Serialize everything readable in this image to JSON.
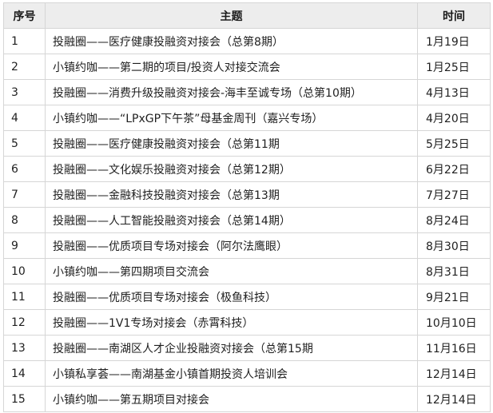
{
  "table": {
    "headers": {
      "no": "序号",
      "topic": "主题",
      "date": "时间"
    },
    "rows": [
      {
        "no": "1",
        "topic": "投融圈——医疗健康投融资对接会（总第8期）",
        "date": "1月19日"
      },
      {
        "no": "2",
        "topic": "小镇约咖——第二期的项目/投资人对接交流会",
        "date": "1月25日"
      },
      {
        "no": "3",
        "topic": "投融圈——消费升级投融资对接会-海丰至诚专场（总第10期）",
        "date": "4月13日"
      },
      {
        "no": "4",
        "topic": "小镇约咖——“LPxGP下午茶”母基金周刊（嘉兴专场）",
        "date": "4月20日"
      },
      {
        "no": "5",
        "topic": "投融圈——医疗健康投融资对接会（总第11期",
        "date": "5月25日"
      },
      {
        "no": "6",
        "topic": "投融圈——文化娱乐投融资对接会（总第12期）",
        "date": "6月22日"
      },
      {
        "no": "7",
        "topic": "投融圈——金融科技投融资对接会（总第13期",
        "date": "7月27日"
      },
      {
        "no": "8",
        "topic": "投融圈——人工智能投融资对接会（总第14期）",
        "date": "8月24日"
      },
      {
        "no": "9",
        "topic": "投融圈——优质项目专场对接会（阿尔法鹰眼）",
        "date": "8月30日"
      },
      {
        "no": "10",
        "topic": "小镇约咖——第四期项目交流会",
        "date": "8月31日"
      },
      {
        "no": "11",
        "topic": "投融圈——优质项目专场对接会（极鱼科技）",
        "date": "9月21日"
      },
      {
        "no": "12",
        "topic": "投融圈——1V1专场对接会（赤霄科技）",
        "date": "10月10日"
      },
      {
        "no": "13",
        "topic": "投融圈——南湖区人才企业投融资对接会（总第15期",
        "date": "11月16日"
      },
      {
        "no": "14",
        "topic": "小镇私享荟——南湖基金小镇首期投资人培训会",
        "date": "12月14日"
      },
      {
        "no": "15",
        "topic": "小镇约咖——第五期项目对接会",
        "date": "12月14日"
      }
    ]
  },
  "colors": {
    "header_bg": "#ededed",
    "border": "#d6d6d6",
    "text": "#1f1f1f"
  }
}
